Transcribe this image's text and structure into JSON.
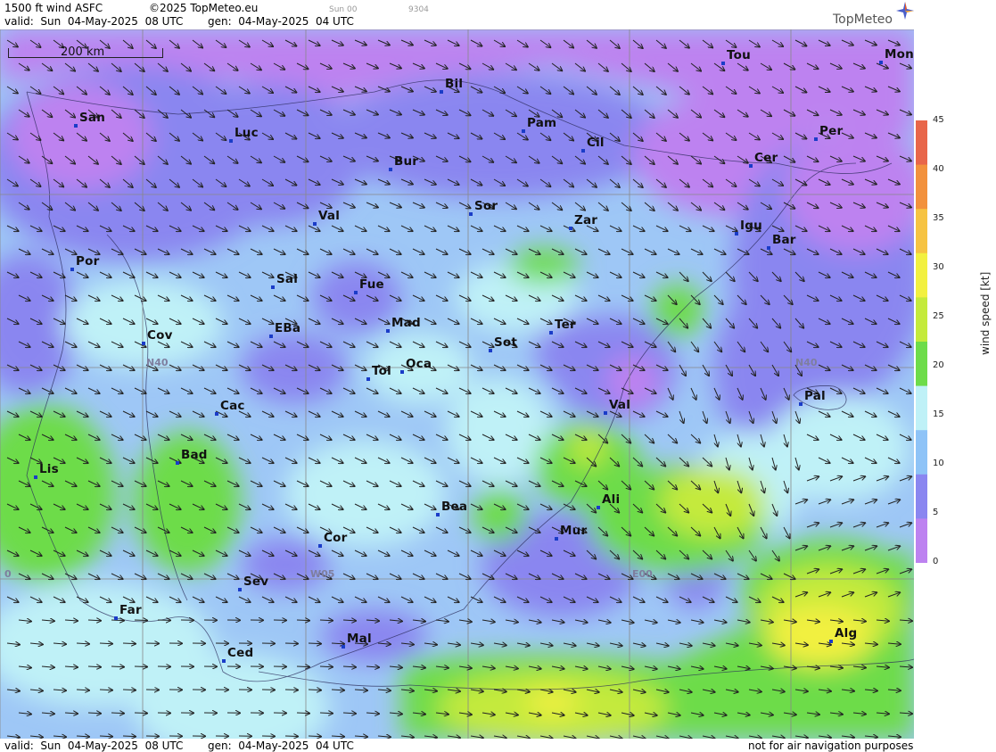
{
  "header": {
    "title": "1500 ft wind ASFC",
    "copyright": "©2025 TopMeteo.eu",
    "valid": "valid:  Sun  04-May-2025  08 UTC",
    "gen": "gen:  04-May-2025  04 UTC",
    "extra_day": "Sun 00",
    "extra_code": "9304"
  },
  "footer": {
    "valid": "valid:  Sun  04-May-2025  08 UTC",
    "gen": "gen:  04-May-2025  04 UTC",
    "disclaimer": "not for air navigation purposes"
  },
  "logo": {
    "text": "TopMeteo",
    "icon": "compass-star-icon"
  },
  "scale": {
    "label": "200 km"
  },
  "grid_labels": [
    "N40",
    "N40",
    "W05",
    "E00",
    "0"
  ],
  "legend": {
    "title": "wind speed [kt]",
    "ticks": [
      "45",
      "40",
      "35",
      "30",
      "25",
      "20",
      "15",
      "10",
      "5",
      "0"
    ],
    "colors": [
      "#e8664a",
      "#f2913d",
      "#f6c342",
      "#f2f040",
      "#c4ea3c",
      "#6ddc4a",
      "#bff1f7",
      "#8ec3f7",
      "#8a86f0",
      "#bd82f0"
    ]
  },
  "cities": [
    {
      "name": "Tou"
    },
    {
      "name": "Mon"
    },
    {
      "name": "Bil"
    },
    {
      "name": "San"
    },
    {
      "name": "Luc"
    },
    {
      "name": "Pam"
    },
    {
      "name": "Cil"
    },
    {
      "name": "Per"
    },
    {
      "name": "Cer"
    },
    {
      "name": "Bur"
    },
    {
      "name": "Sor"
    },
    {
      "name": "Val"
    },
    {
      "name": "Zar"
    },
    {
      "name": "Igu"
    },
    {
      "name": "Bar"
    },
    {
      "name": "Por"
    },
    {
      "name": "Sal"
    },
    {
      "name": "Fue"
    },
    {
      "name": "Mad"
    },
    {
      "name": "Cov"
    },
    {
      "name": "EBa"
    },
    {
      "name": "Sot"
    },
    {
      "name": "Ter"
    },
    {
      "name": "Tol"
    },
    {
      "name": "Oca"
    },
    {
      "name": "Cac"
    },
    {
      "name": "Val"
    },
    {
      "name": "Pal"
    },
    {
      "name": "Bad"
    },
    {
      "name": "Lis"
    },
    {
      "name": "Ali"
    },
    {
      "name": "Bea"
    },
    {
      "name": "Cor"
    },
    {
      "name": "Mur"
    },
    {
      "name": "Sev"
    },
    {
      "name": "Far"
    },
    {
      "name": "Mal"
    },
    {
      "name": "Alg"
    },
    {
      "name": "Ced"
    }
  ]
}
